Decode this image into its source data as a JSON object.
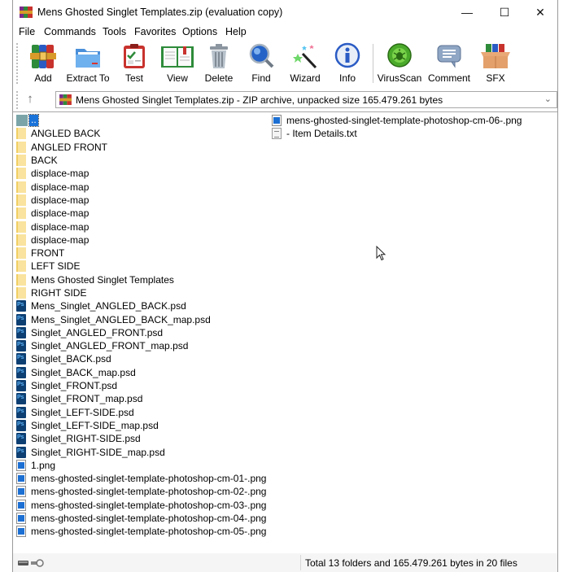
{
  "window": {
    "title": "Mens Ghosted Singlet Templates.zip (evaluation copy)",
    "controls": {
      "minimize": "—",
      "maximize": "☐",
      "close": "✕"
    }
  },
  "menu": [
    "File",
    "Commands",
    "Tools",
    "Favorites",
    "Options",
    "Help"
  ],
  "toolbar": [
    {
      "label": "Add",
      "icon": "add-archive-icon"
    },
    {
      "label": "Extract To",
      "icon": "extract-folder-icon"
    },
    {
      "label": "Test",
      "icon": "test-clipboard-icon"
    },
    {
      "label": "View",
      "icon": "view-book-icon"
    },
    {
      "label": "Delete",
      "icon": "trash-icon"
    },
    {
      "label": "Find",
      "icon": "magnifier-icon"
    },
    {
      "label": "Wizard",
      "icon": "magic-wand-icon"
    },
    {
      "label": "Info",
      "icon": "info-icon"
    },
    {
      "label": "VirusScan",
      "icon": "virus-scan-icon"
    },
    {
      "label": "Comment",
      "icon": "comment-icon"
    },
    {
      "label": "SFX",
      "icon": "sfx-box-icon"
    }
  ],
  "address": {
    "up_arrow": "↑",
    "text": "Mens Ghosted Singlet Templates.zip - ZIP archive, unpacked size 165.479.261 bytes",
    "chevron": "⌄"
  },
  "files_col1": [
    {
      "name": "..",
      "type": "up"
    },
    {
      "name": "ANGLED BACK",
      "type": "folder"
    },
    {
      "name": "ANGLED FRONT",
      "type": "folder"
    },
    {
      "name": "BACK",
      "type": "folder"
    },
    {
      "name": "displace-map",
      "type": "folder"
    },
    {
      "name": "displace-map",
      "type": "folder"
    },
    {
      "name": "displace-map",
      "type": "folder"
    },
    {
      "name": "displace-map",
      "type": "folder"
    },
    {
      "name": "displace-map",
      "type": "folder"
    },
    {
      "name": "displace-map",
      "type": "folder"
    },
    {
      "name": "FRONT",
      "type": "folder"
    },
    {
      "name": "LEFT SIDE",
      "type": "folder"
    },
    {
      "name": "Mens Ghosted Singlet Templates",
      "type": "folder"
    },
    {
      "name": "RIGHT SIDE",
      "type": "folder"
    },
    {
      "name": "Mens_Singlet_ANGLED_BACK.psd",
      "type": "psd"
    },
    {
      "name": "Mens_Singlet_ANGLED_BACK_map.psd",
      "type": "psd"
    },
    {
      "name": "Singlet_ANGLED_FRONT.psd",
      "type": "psd"
    },
    {
      "name": "Singlet_ANGLED_FRONT_map.psd",
      "type": "psd"
    },
    {
      "name": "Singlet_BACK.psd",
      "type": "psd"
    },
    {
      "name": "Singlet_BACK_map.psd",
      "type": "psd"
    },
    {
      "name": "Singlet_FRONT.psd",
      "type": "psd"
    },
    {
      "name": "Singlet_FRONT_map.psd",
      "type": "psd"
    },
    {
      "name": "Singlet_LEFT-SIDE.psd",
      "type": "psd"
    },
    {
      "name": "Singlet_LEFT-SIDE_map.psd",
      "type": "psd"
    },
    {
      "name": "Singlet_RIGHT-SIDE.psd",
      "type": "psd"
    },
    {
      "name": "Singlet_RIGHT-SIDE_map.psd",
      "type": "psd"
    },
    {
      "name": "1.png",
      "type": "png"
    },
    {
      "name": "mens-ghosted-singlet-template-photoshop-cm-01-.png",
      "type": "png"
    },
    {
      "name": "mens-ghosted-singlet-template-photoshop-cm-02-.png",
      "type": "png"
    },
    {
      "name": "mens-ghosted-singlet-template-photoshop-cm-03-.png",
      "type": "png"
    },
    {
      "name": "mens-ghosted-singlet-template-photoshop-cm-04-.png",
      "type": "png"
    },
    {
      "name": "mens-ghosted-singlet-template-photoshop-cm-05-.png",
      "type": "png"
    }
  ],
  "files_col2": [
    {
      "name": "mens-ghosted-singlet-template-photoshop-cm-06-.png",
      "type": "png"
    },
    {
      "name": "- Item Details.txt",
      "type": "txt"
    }
  ],
  "status": {
    "text": "Total 13 folders and 165.479.261 bytes in 20 files"
  }
}
